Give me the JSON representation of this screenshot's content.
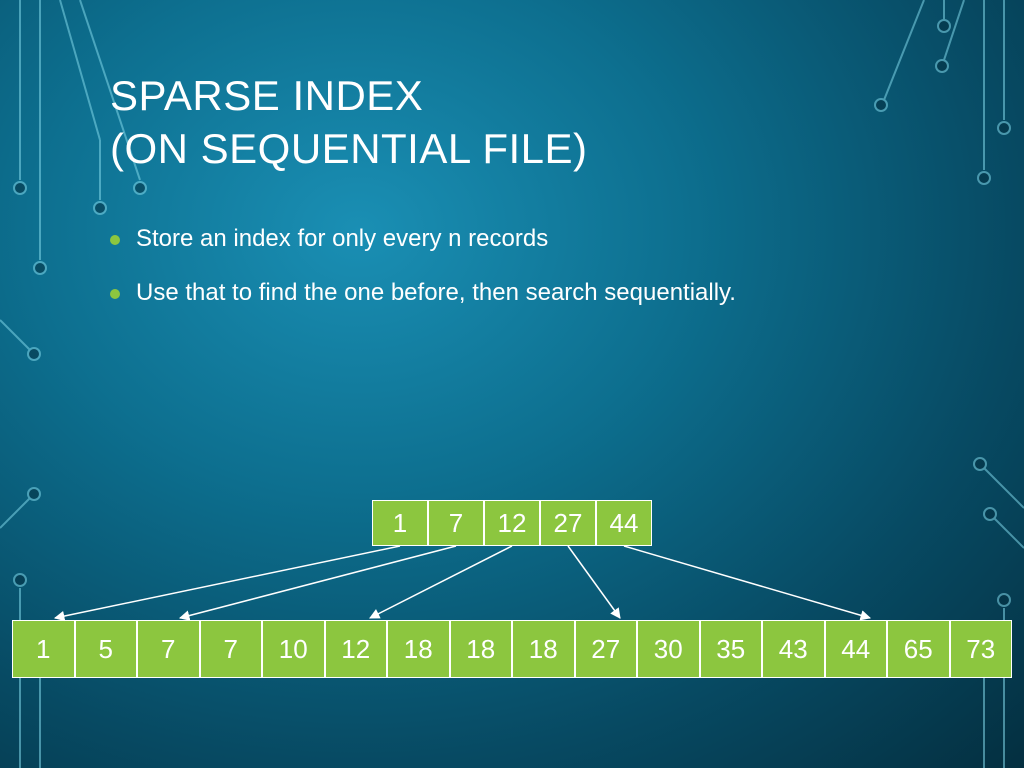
{
  "title": {
    "line1": "SPARSE INDEX",
    "line2": "(ON SEQUENTIAL FILE)"
  },
  "bullets": [
    "Store an index for only every n records",
    "Use that to find the one before, then search sequentially."
  ],
  "chart_data": {
    "type": "table",
    "index_row": [
      1,
      7,
      12,
      27,
      44
    ],
    "data_row": [
      1,
      5,
      7,
      7,
      10,
      12,
      18,
      18,
      18,
      27,
      30,
      35,
      43,
      44,
      65,
      73
    ]
  }
}
